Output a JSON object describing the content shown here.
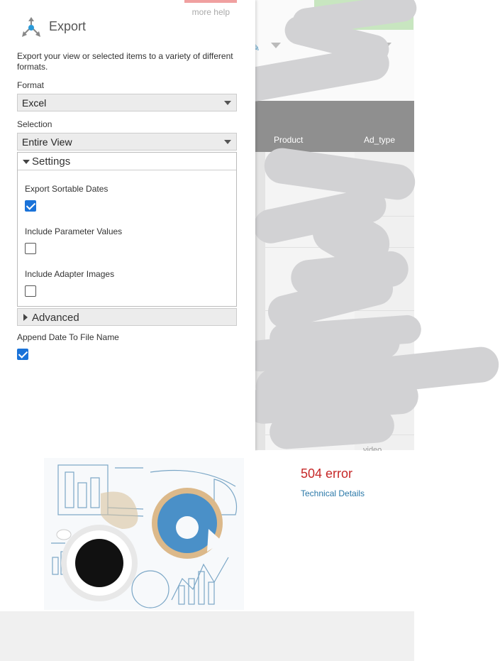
{
  "panel": {
    "help_link": "more help",
    "title": "Export",
    "description": "Export your view or selected items to a variety of different formats.",
    "format_label": "Format",
    "format_value": "Excel",
    "selection_label": "Selection",
    "selection_value": "Entire View",
    "settings": {
      "header": "Settings",
      "options": [
        {
          "label": "Export Sortable Dates",
          "checked": true
        },
        {
          "label": "Include Parameter Values",
          "checked": false
        },
        {
          "label": "Include Adapter Images",
          "checked": false
        }
      ]
    },
    "advanced_label": "Advanced",
    "append_date_label": "Append Date To File Name",
    "append_date_checked": true
  },
  "grid": {
    "columns": [
      "Product",
      "Ad_type"
    ],
    "cell_fragment": "video"
  },
  "error": {
    "title": "504 error",
    "link": "Technical Details"
  },
  "icons": [
    "export-icon",
    "caret-down-icon",
    "triangle-down-icon",
    "triangle-right-icon",
    "checkmark-icon",
    "chart-tool-icon"
  ],
  "colors": {
    "accent": "#1a73d9",
    "error_red": "#c62828",
    "link_blue": "#2a78a8",
    "grid_header": "#8f8f8f"
  }
}
